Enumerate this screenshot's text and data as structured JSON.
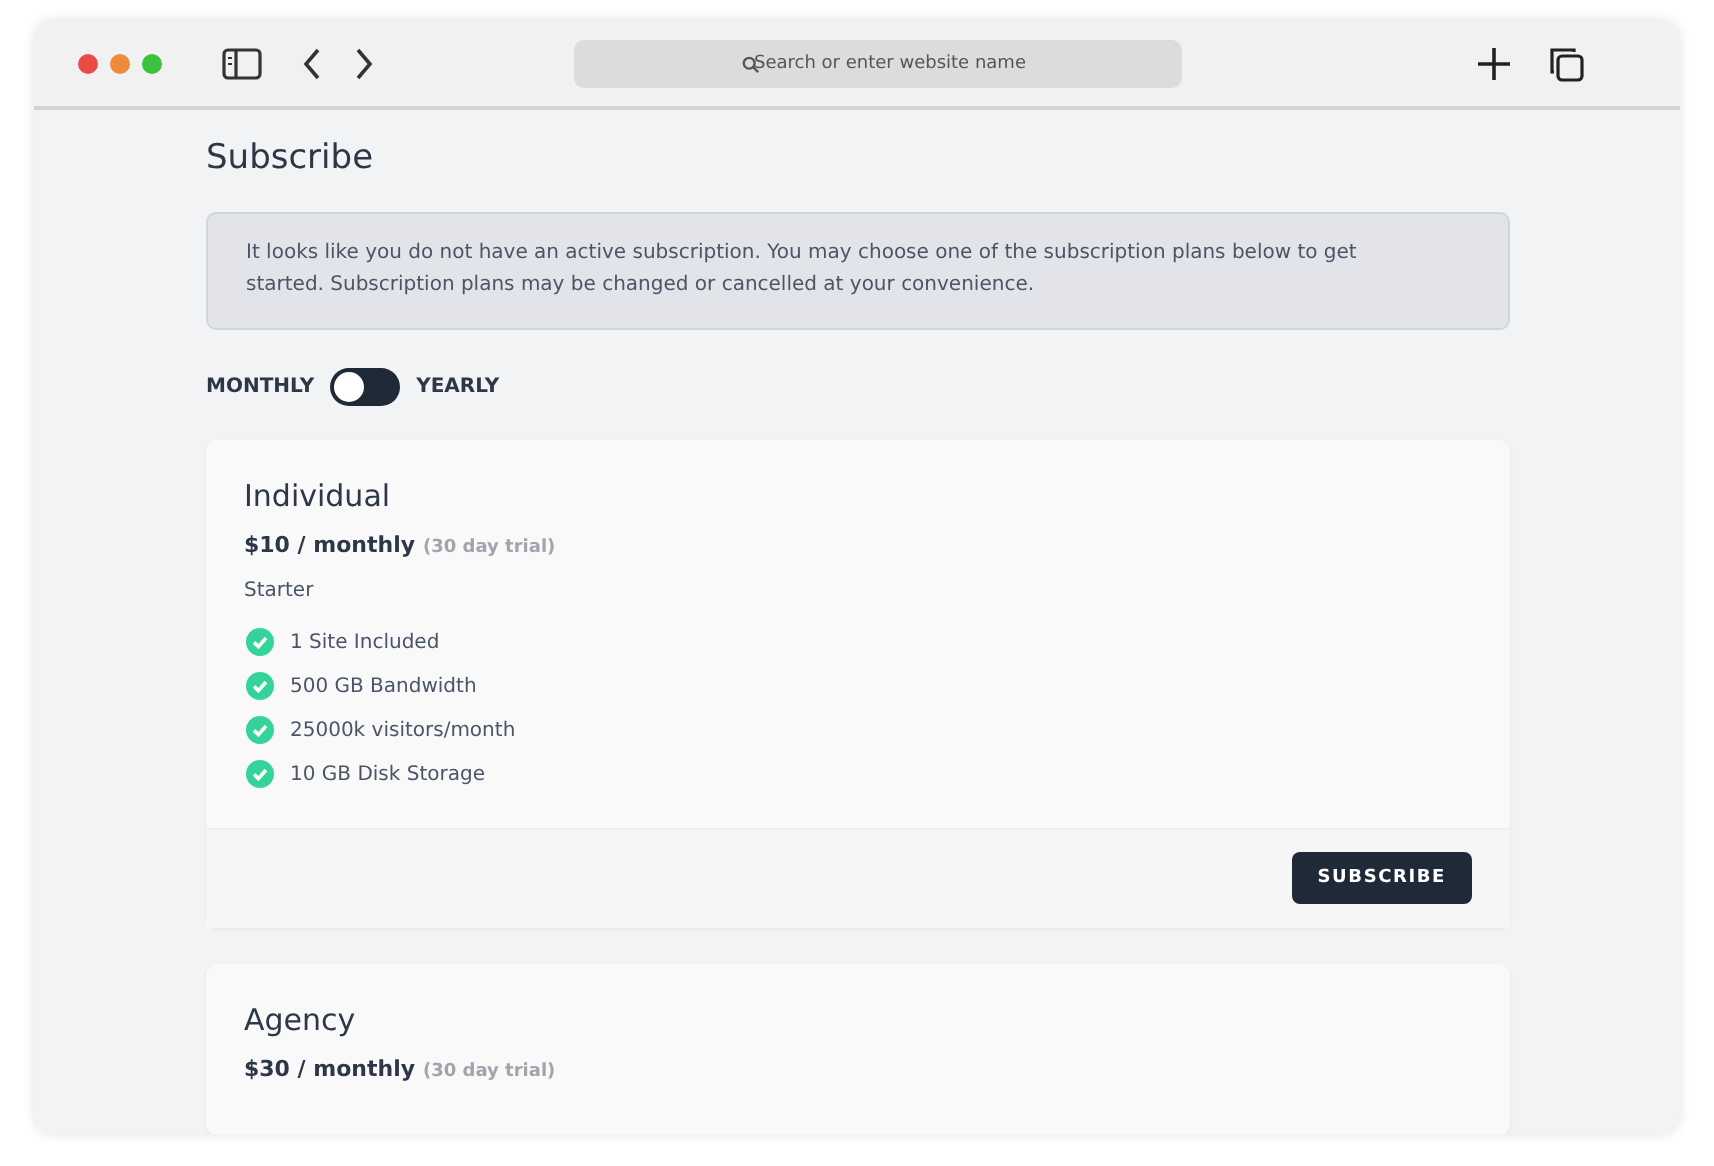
{
  "browser": {
    "address_placeholder": "Search or enter website name"
  },
  "page": {
    "title": "Subscribe",
    "notice": "It looks like you do not have an active subscription. You may choose one of the subscription plans below to get started. Subscription plans may be changed or cancelled at your convenience."
  },
  "billing_toggle": {
    "left_label": "MONTHLY",
    "right_label": "YEARLY",
    "on": false
  },
  "plans": [
    {
      "name": "Individual",
      "price": "$10 / monthly",
      "trial": "(30 day trial)",
      "tier": "Starter",
      "features": [
        {
          "text": "1 Site Included",
          "included": true
        },
        {
          "text": "500 GB Bandwidth",
          "included": true
        },
        {
          "text": "25000k visitors/month",
          "included": true
        },
        {
          "text": "10 GB Disk Storage",
          "included": true
        }
      ],
      "button": "SUBSCRIBE"
    },
    {
      "name": "Agency",
      "price": "$30 / monthly",
      "trial": "(30 day trial)"
    }
  ]
}
